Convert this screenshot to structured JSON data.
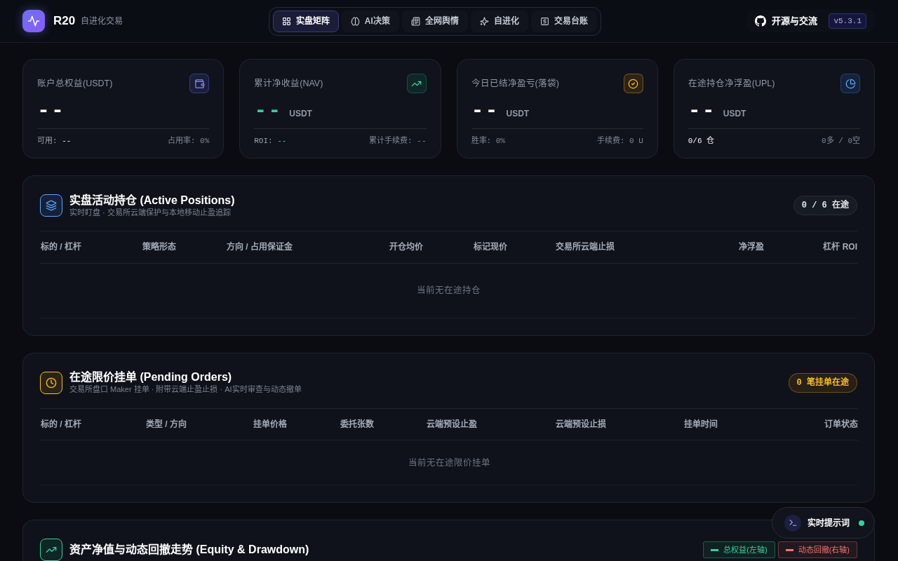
{
  "header": {
    "brand": {
      "name": "R20",
      "tagline": "自进化交易"
    },
    "tabs": [
      {
        "label": "实盘矩阵",
        "selected": true
      },
      {
        "label": "AI决策",
        "selected": false
      },
      {
        "label": "全网舆情",
        "selected": false
      },
      {
        "label": "自进化",
        "selected": false
      },
      {
        "label": "交易台账",
        "selected": false
      }
    ],
    "repo_link": "开源与交流",
    "version": "v5.3.1"
  },
  "stats": [
    {
      "label": "账户总权益(USDT)",
      "value": "--",
      "positive": false,
      "footer_left": {
        "label": "可用:",
        "value": "--",
        "emphasis": true
      },
      "footer_right": "占用率: 0%"
    },
    {
      "label": "累计净收益(NAV)",
      "value": "--",
      "unit": "USDT",
      "positive": true,
      "footer_left": {
        "label": "ROI:",
        "value": "--",
        "emphasis": true
      },
      "footer_right": "累计手续费: --"
    },
    {
      "label": "今日已结净盈亏(落袋)",
      "value": "--",
      "unit": "USDT",
      "positive": false,
      "footer_left": {
        "label": "胜率:",
        "value": "0%",
        "emphasis": false
      },
      "footer_right": "手续费: 0 U"
    },
    {
      "label": "在途持仓净浮盈(UPL)",
      "value": "--",
      "unit": "USDT",
      "positive": false,
      "footer_left": {
        "value": "0/6 仓",
        "emphasis": true
      },
      "footer_right": "0多 / 0空"
    }
  ],
  "panels": [
    {
      "kind": "table",
      "title": "实盘活动持仓 (Active Positions)",
      "subtitle": "实时盯盘 · 交易所云端保护与本地移动止盈追踪",
      "badge": {
        "text": "0 / 6 在途",
        "alert": false
      },
      "columns": [
        "标的 / 杠杆",
        "策略形态",
        "方向 / 占用保证金",
        "开仓均价",
        "标记现价",
        "交易所云端止损",
        "净浮盈",
        "杠杆 ROI"
      ],
      "empty_text": "当前无在途持仓"
    },
    {
      "kind": "table",
      "title": "在途限价挂单 (Pending Orders)",
      "subtitle": "交易所盘口 Maker 挂单 · 附带云端止盈止损 · AI实时审查与动态撤单",
      "badge": {
        "text": "0 笔挂单在途",
        "alert": true
      },
      "columns": [
        "标的 / 杠杆",
        "类型 / 方向",
        "挂单价格",
        "委托张数",
        "云端预设止盈",
        "云端预设止损",
        "挂单时间",
        "订单状态"
      ],
      "empty_text": "当前无在途限价挂单"
    },
    {
      "kind": "chart",
      "title": "资产净值与动态回撤走势 (Equity & Drawdown)",
      "legend": [
        {
          "label": "总权益(左轴)",
          "color": "#34d399"
        },
        {
          "label": "动态回撤(右轴)",
          "color": "#f87171"
        }
      ]
    }
  ],
  "prompt_button": {
    "label": "实时提示词",
    "online": true
  }
}
